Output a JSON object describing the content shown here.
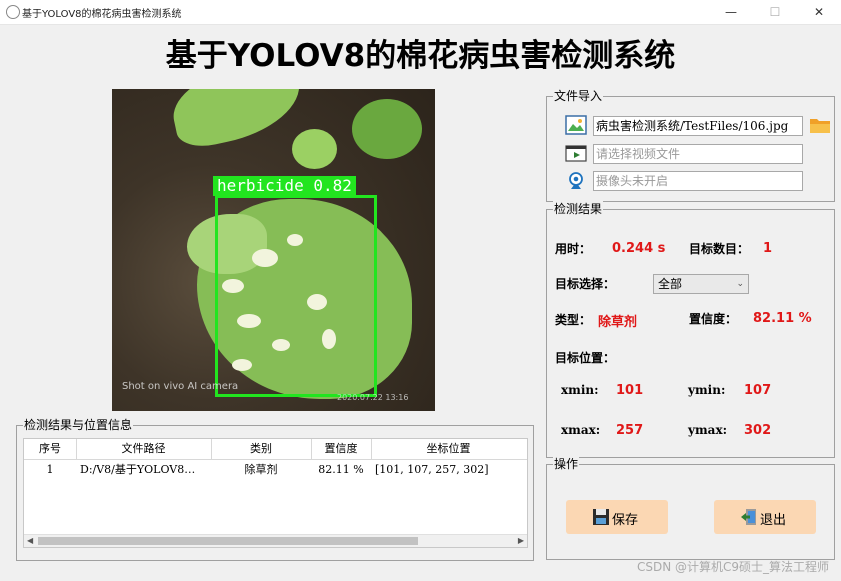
{
  "window": {
    "title": "基于YOLOV8的棉花病虫害检测系统",
    "min": "—",
    "max": "☐",
    "close": "✕"
  },
  "main_title": "基于YOLOV8的棉花病虫害检测系统",
  "photo": {
    "detection_label": "herbicide 0.82",
    "watermark": "Shot on vivo AI camera",
    "date_stamp": "2020.07.22 13:16"
  },
  "import": {
    "title": "文件导入",
    "image_path": "病虫害检测系统/TestFiles/106.jpg",
    "video_placeholder": "请选择视频文件",
    "camera_placeholder": "摄像头未开启"
  },
  "result": {
    "title": "检测结果",
    "time_label": "用时：",
    "time_value": "0.244 s",
    "count_label": "目标数目：",
    "count_value": "1",
    "select_label": "目标选择：",
    "select_value": "全部",
    "type_label": "类型：",
    "type_value": "除草剂",
    "conf_label": "置信度：",
    "conf_value": "82.11 %",
    "pos_label": "目标位置：",
    "xmin_label": "xmin:",
    "xmin_value": "101",
    "ymin_label": "ymin:",
    "ymin_value": "107",
    "xmax_label": "xmax:",
    "xmax_value": "257",
    "ymax_label": "ymax:",
    "ymax_value": "302"
  },
  "ops": {
    "title": "操作",
    "save": "保存",
    "exit": "退出"
  },
  "table": {
    "title": "检测结果与位置信息",
    "headers": [
      "序号",
      "文件路径",
      "类别",
      "置信度",
      "坐标位置"
    ],
    "rows": [
      {
        "index": "1",
        "path": "D:/V8/基于YOLOV8…",
        "class": "除草剂",
        "conf": "82.11 %",
        "box": "[101, 107, 257, 302]"
      }
    ]
  },
  "footer": "CSDN @计算机C9硕士_算法工程师",
  "colors": {
    "accent_red": "#e01818",
    "detect_green": "#22e51f",
    "button_orange": "#fbd7b3"
  }
}
